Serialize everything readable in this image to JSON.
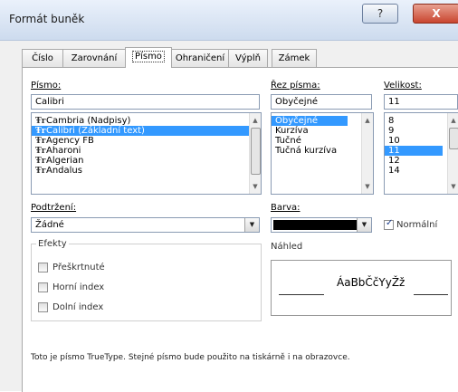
{
  "window": {
    "title": "Formát buněk",
    "help": "?",
    "close": "X"
  },
  "tabs": [
    "Číslo",
    "Zarovnání",
    "Písmo",
    "Ohraničení",
    "Výplň",
    "Zámek"
  ],
  "font": {
    "label": "Písmo:",
    "value": "Calibri",
    "items": [
      {
        "icon": "Ŧr",
        "label": "Cambria (Nadpisy)",
        "selected": false
      },
      {
        "icon": "Ŧr",
        "label": "Calibri (Základní text)",
        "selected": true
      },
      {
        "icon": "Ŧr",
        "label": "Agency FB",
        "selected": false
      },
      {
        "icon": "Ŧr",
        "label": "Aharoni",
        "selected": false
      },
      {
        "icon": "Ŧr",
        "label": "Algerian",
        "selected": false
      },
      {
        "icon": "Ŧr",
        "label": "Andalus",
        "selected": false
      }
    ]
  },
  "style": {
    "label": "Řez písma:",
    "value": "Obyčejné",
    "items": [
      {
        "label": "Obyčejné",
        "selected": true
      },
      {
        "label": "Kurzíva",
        "selected": false
      },
      {
        "label": "Tučné",
        "selected": false
      },
      {
        "label": "Tučná kurzíva",
        "selected": false
      }
    ]
  },
  "size": {
    "label": "Velikost:",
    "value": "11",
    "items": [
      {
        "label": "8",
        "selected": false
      },
      {
        "label": "9",
        "selected": false
      },
      {
        "label": "10",
        "selected": false
      },
      {
        "label": "11",
        "selected": true
      },
      {
        "label": "12",
        "selected": false
      },
      {
        "label": "14",
        "selected": false
      }
    ]
  },
  "underline": {
    "label": "Podtržení:",
    "value": "Žádné"
  },
  "color": {
    "label": "Barva:",
    "swatch": "#000000",
    "normal_label": "Normální",
    "normal_checked": true
  },
  "effects": {
    "label": "Efekty",
    "items": [
      {
        "label": "Přeškrtnuté",
        "checked": false
      },
      {
        "label": "Horní index",
        "checked": false
      },
      {
        "label": "Dolní index",
        "checked": false
      }
    ]
  },
  "preview": {
    "label": "Náhled",
    "text": "ÁaBbČčYyŽž"
  },
  "info": "Toto je písmo TrueType. Stejné písmo bude použito na tiskárně i na obrazovce."
}
